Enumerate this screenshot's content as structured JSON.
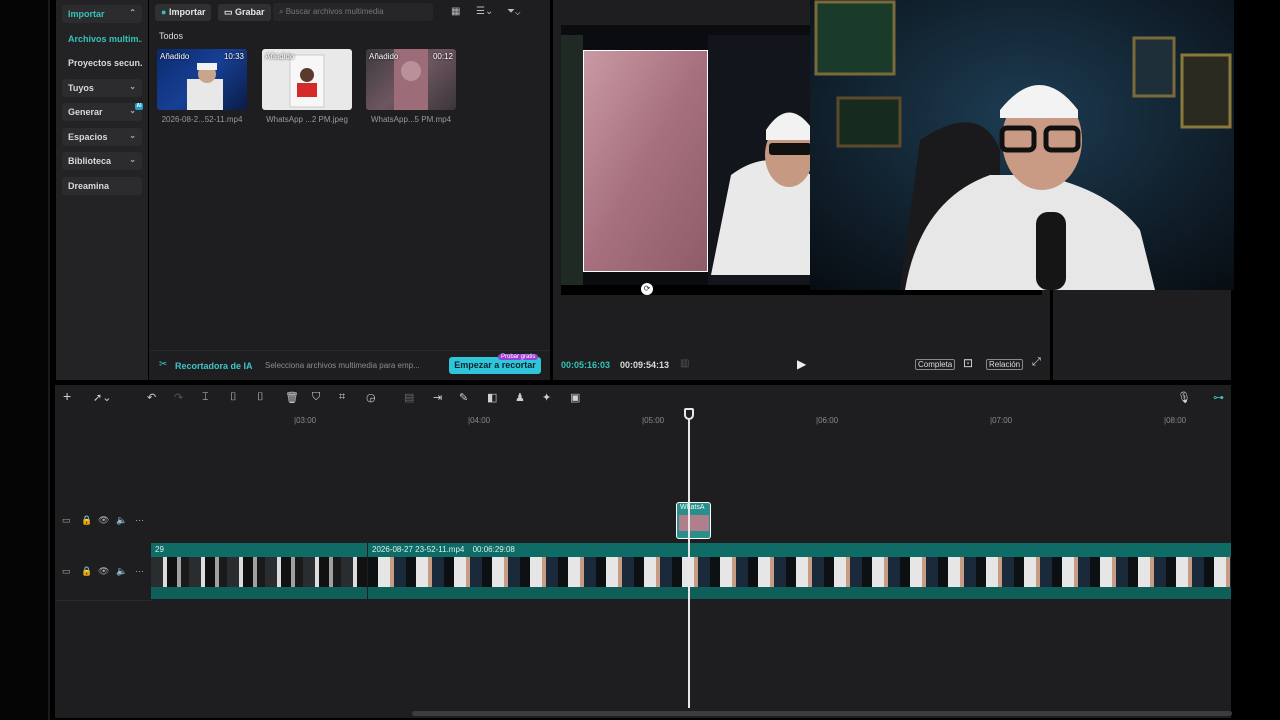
{
  "sidebar": {
    "items": [
      {
        "label": "Importar",
        "boxed": true,
        "active": true,
        "chevron": "chevron-up-icon"
      },
      {
        "label": "Archivos multim...",
        "boxed": false,
        "active": true
      },
      {
        "label": "Proyectos secun...",
        "boxed": false,
        "active": false
      },
      {
        "label": "Tuyos",
        "boxed": true,
        "active": false,
        "chevron": "chevron-down-icon"
      },
      {
        "label": "Generar",
        "boxed": true,
        "active": false,
        "chevron": "chevron-down-icon",
        "badge": "AI"
      },
      {
        "label": "Espacios",
        "boxed": true,
        "active": false,
        "chevron": "chevron-down-icon"
      },
      {
        "label": "Biblioteca",
        "boxed": true,
        "active": false,
        "chevron": "chevron-down-icon"
      },
      {
        "label": "Dreamina",
        "boxed": true,
        "active": false
      }
    ]
  },
  "media": {
    "import_label": "Importar",
    "record_label": "Grabar",
    "search_placeholder": "Buscar archivos multimedia",
    "section_label": "Todos",
    "items": [
      {
        "tag": "Añadido",
        "duration": "10:33",
        "name": "2026-08-2...52-11.mp4"
      },
      {
        "tag": "Añadido",
        "duration": "",
        "name": "WhatsApp ...2 PM.jpeg"
      },
      {
        "tag": "Añadido",
        "duration": "00:12",
        "name": "WhatsApp...5 PM.mp4"
      }
    ],
    "ia_title": "Recortadora de IA",
    "ia_desc": "Selecciona archivos multimedia para emp...",
    "ia_button": "Empezar a recortar",
    "ia_badge": "Probar gratis"
  },
  "preview": {
    "current_time": "00:05:16:03",
    "total_time": "00:09:54:13",
    "full_label": "Completa",
    "ratio_label": "Relación"
  },
  "timeline": {
    "ruler": [
      "|03:00",
      "|04:00",
      "|05:00",
      "|06:00",
      "|07:00",
      "|08:00"
    ],
    "overlay_clip_label": "WhatsA",
    "clip_a_label": "29",
    "clip_b_label": "2026-08-27 23-52-11.mp4",
    "clip_b_duration": "00:06:29:08"
  },
  "colors": {
    "accent": "#34c3b8",
    "clip": "#0e6b66",
    "button": "#2ec6d8"
  }
}
